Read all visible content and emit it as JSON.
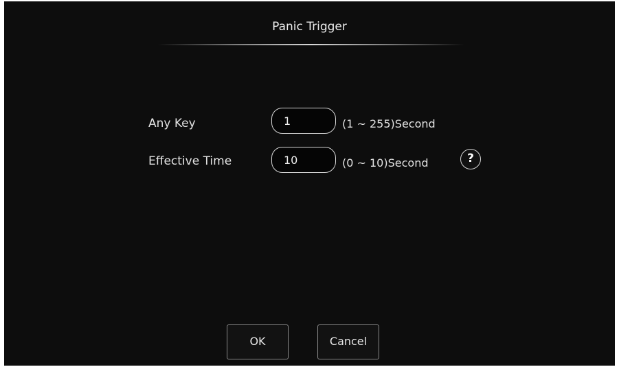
{
  "dialog": {
    "title": "Panic Trigger"
  },
  "fields": [
    {
      "label": "Any Key",
      "value": "1",
      "hint": "(1 ~ 255)Second"
    },
    {
      "label": "Effective Time",
      "value": "10",
      "hint": "(0 ~ 10)Second"
    }
  ],
  "help": {
    "symbol": "?",
    "icon": "question-mark-icon"
  },
  "buttons": {
    "ok": "OK",
    "cancel": "Cancel"
  }
}
